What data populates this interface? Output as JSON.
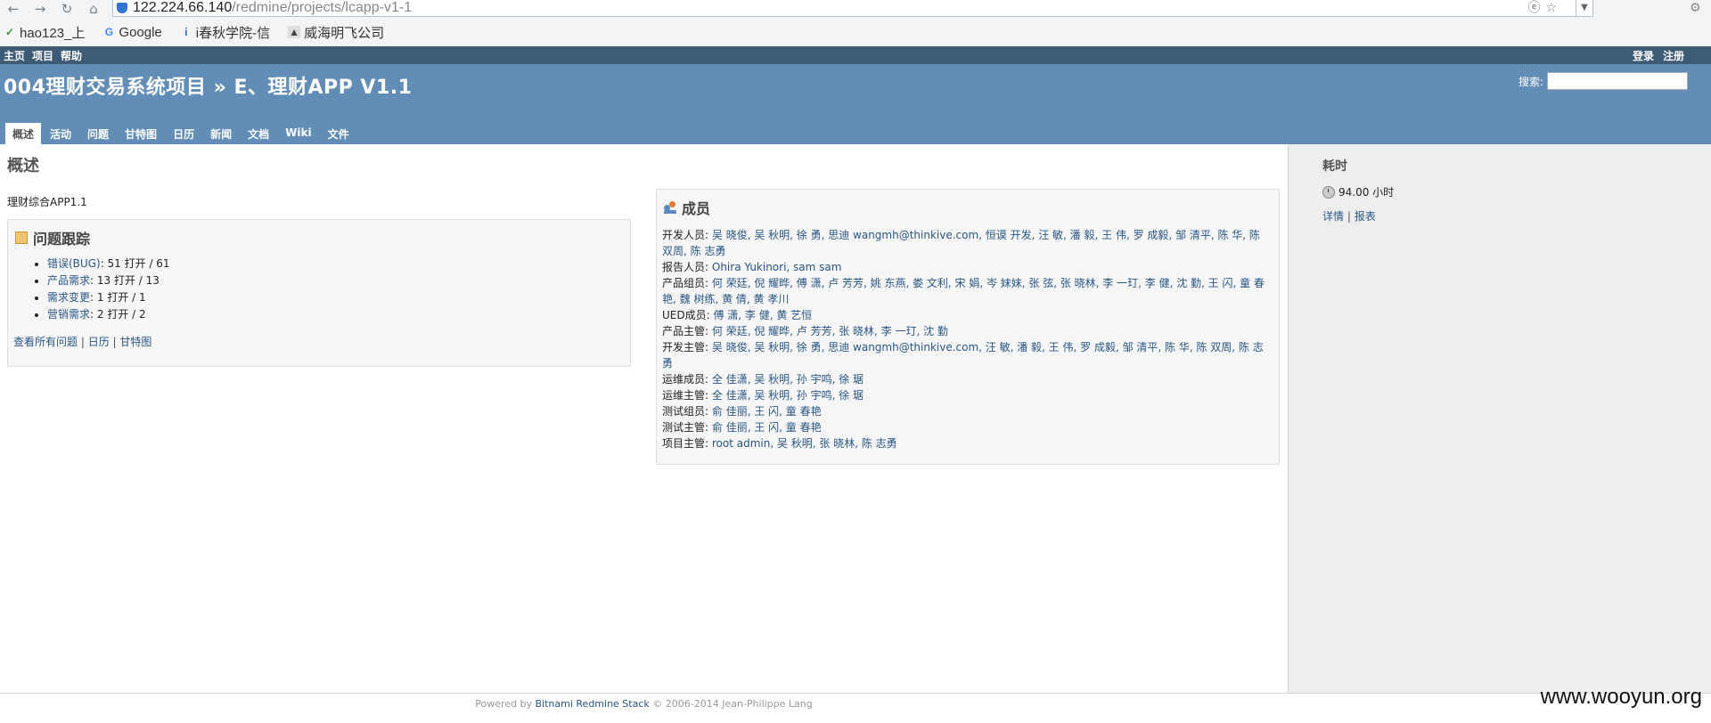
{
  "browser": {
    "url_host": "122.224.66.140",
    "url_path": "/redmine/projects/lcapp-v1-1",
    "bookmarks": [
      {
        "label": "hao123_上"
      },
      {
        "label": "Google"
      },
      {
        "label": "i春秋学院-信"
      },
      {
        "label": "威海明飞公司"
      }
    ]
  },
  "top_menu": {
    "left": [
      "主页",
      "项目",
      "帮助"
    ],
    "right": [
      "登录",
      "注册"
    ]
  },
  "header": {
    "title": "004理财交易系统项目 » E、理财APP V1.1",
    "search_label": "搜索:",
    "search_value": ""
  },
  "main_menu": [
    "概述",
    "活动",
    "问题",
    "甘特图",
    "日历",
    "新闻",
    "文档",
    "Wiki",
    "文件"
  ],
  "content": {
    "page_title": "概述",
    "description": "理财综合APP1.1",
    "issues": {
      "title": "问题跟踪",
      "trackers": [
        {
          "name": "错误(BUG)",
          "stats": ": 51 打开 / 61"
        },
        {
          "name": "产品需求",
          "stats": ": 13 打开 / 13"
        },
        {
          "name": "需求变更",
          "stats": ": 1 打开 / 1"
        },
        {
          "name": "营销需求",
          "stats": ": 2 打开 / 2"
        }
      ],
      "links": [
        "查看所有问题",
        "日历",
        "甘特图"
      ]
    },
    "members": {
      "title": "成员",
      "rows": [
        {
          "role": "开发人员:",
          "names": "吴 晓俊, 吴 秋明, 徐 勇, 思迪 wangmh@thinkive.com, 恒谟 开发, 汪 敏, 潘 毅, 王 伟, 罗 成毅, 邹 清平, 陈 华, 陈 双周, 陈 志勇"
        },
        {
          "role": "报告人员:",
          "names": "Ohira Yukinori, sam sam"
        },
        {
          "role": "产品组员:",
          "names": "何 荣廷, 倪 耀晔, 傅 潇, 卢 芳芳, 姚 东燕, 娄 文利, 宋 娟, 岑 妹妹, 张 弦, 张 晓林, 李 一玎, 李 健, 沈 勤, 王 闪, 童 春艳, 魏 树练, 黄 倩, 黄 孝川"
        },
        {
          "role": "UED成员:",
          "names": "傅 潇, 李 健, 黄 艺恒"
        },
        {
          "role": "产品主管:",
          "names": "何 荣廷, 倪 耀晔, 卢 芳芳, 张 晓林, 李 一玎, 沈 勤"
        },
        {
          "role": "开发主管:",
          "names": "吴 晓俊, 吴 秋明, 徐 勇, 思迪 wangmh@thinkive.com, 汪 敏, 潘 毅, 王 伟, 罗 成毅, 邹 清平, 陈 华, 陈 双周, 陈 志勇"
        },
        {
          "role": "运维成员:",
          "names": "全 佳潇, 吴 秋明, 孙 宇鸣, 徐 琚"
        },
        {
          "role": "运维主管:",
          "names": "全 佳潇, 吴 秋明, 孙 宇鸣, 徐 琚"
        },
        {
          "role": "测试组员:",
          "names": "俞 佳丽, 王 闪, 童 春艳"
        },
        {
          "role": "测试主管:",
          "names": "俞 佳丽, 王 闪, 童 春艳"
        },
        {
          "role": "项目主管:",
          "names": "root admin, 吴 秋明, 张 晓林, 陈 志勇"
        }
      ]
    }
  },
  "sidebar": {
    "title": "耗时",
    "hours": "94.00 小时",
    "links": [
      "详情",
      "报表"
    ]
  },
  "footer": {
    "prefix": "Powered by",
    "link": "Bitnami Redmine Stack",
    "suffix": "© 2006-2014 Jean-Philippe Lang"
  },
  "watermark": "www.wooyun.org",
  "colors": {
    "top_menu_bg": "#3e5b76",
    "header_bg": "#628db6",
    "link": "#2a5685",
    "sidebar_bg": "#eeeeee"
  }
}
